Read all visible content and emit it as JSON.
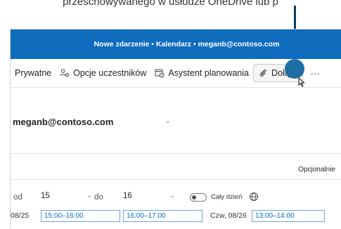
{
  "doc_fragment": "przeschowywanego w usłudze OneDrive lub p",
  "window": {
    "title": "Nowe zdarzenie • Kalendarz • meganb@contoso.com"
  },
  "toolbar": {
    "private_label": "Prywatne",
    "attendee_options_label": "Opcje uczestników",
    "scheduling_assistant_label": "Asystent planowania",
    "attach_label": "Dołącz",
    "more_label": "···"
  },
  "from": {
    "account": "meganb@contoso.com"
  },
  "attendees": {
    "optional_label": "Opcjonalnie"
  },
  "schedule": {
    "from_label": "od",
    "start_value": "15",
    "to_label": "do",
    "end_value": "16",
    "all_day_label": "Cały dzień",
    "all_day_on": false
  },
  "suggestions": {
    "date1": "08/25",
    "slot1": "15:00–16:00",
    "slot2": "16:00–17:00",
    "date2": "Czw, 08/26",
    "slot3": "13:00–14:00"
  },
  "colors": {
    "titlebar": "#0f6cbd",
    "callout": "#1d6fa5"
  }
}
